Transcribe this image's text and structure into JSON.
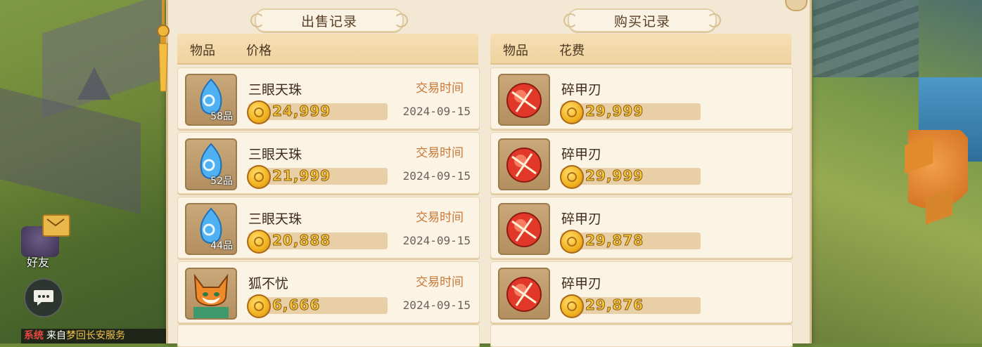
{
  "hud": {
    "friend_label": "好友",
    "system_tag": "系统",
    "system_from": "来自",
    "system_server": "梦回长安服务"
  },
  "sales": {
    "title": "出售记录",
    "col_item": "物品",
    "col_value": "价格",
    "time_label": "交易时间",
    "rows": [
      {
        "name": "三眼天珠",
        "grade": "58品",
        "price": "24,999",
        "date": "2024-09-15",
        "icon": "blue-bead-icon"
      },
      {
        "name": "三眼天珠",
        "grade": "52品",
        "price": "21,999",
        "date": "2024-09-15",
        "icon": "blue-bead-icon"
      },
      {
        "name": "三眼天珠",
        "grade": "44品",
        "price": "20,888",
        "date": "2024-09-15",
        "icon": "blue-bead-icon"
      },
      {
        "name": "狐不忧",
        "grade": "",
        "price": "6,666",
        "date": "2024-09-15",
        "icon": "fox-pet-icon"
      }
    ]
  },
  "purchases": {
    "title": "购买记录",
    "col_item": "物品",
    "col_value": "花费",
    "rows": [
      {
        "name": "碎甲刃",
        "price": "29,999",
        "icon": "red-orb-icon"
      },
      {
        "name": "碎甲刃",
        "price": "29,999",
        "icon": "red-orb-icon"
      },
      {
        "name": "碎甲刃",
        "price": "29,878",
        "icon": "red-orb-icon"
      },
      {
        "name": "碎甲刃",
        "price": "29,876",
        "icon": "red-orb-icon"
      }
    ]
  },
  "colors": {
    "panel_bg": "#f3e8d3",
    "header_bg": "#efd3a0",
    "time_label": "#c8783a",
    "coin_text": "#f6c93a"
  }
}
